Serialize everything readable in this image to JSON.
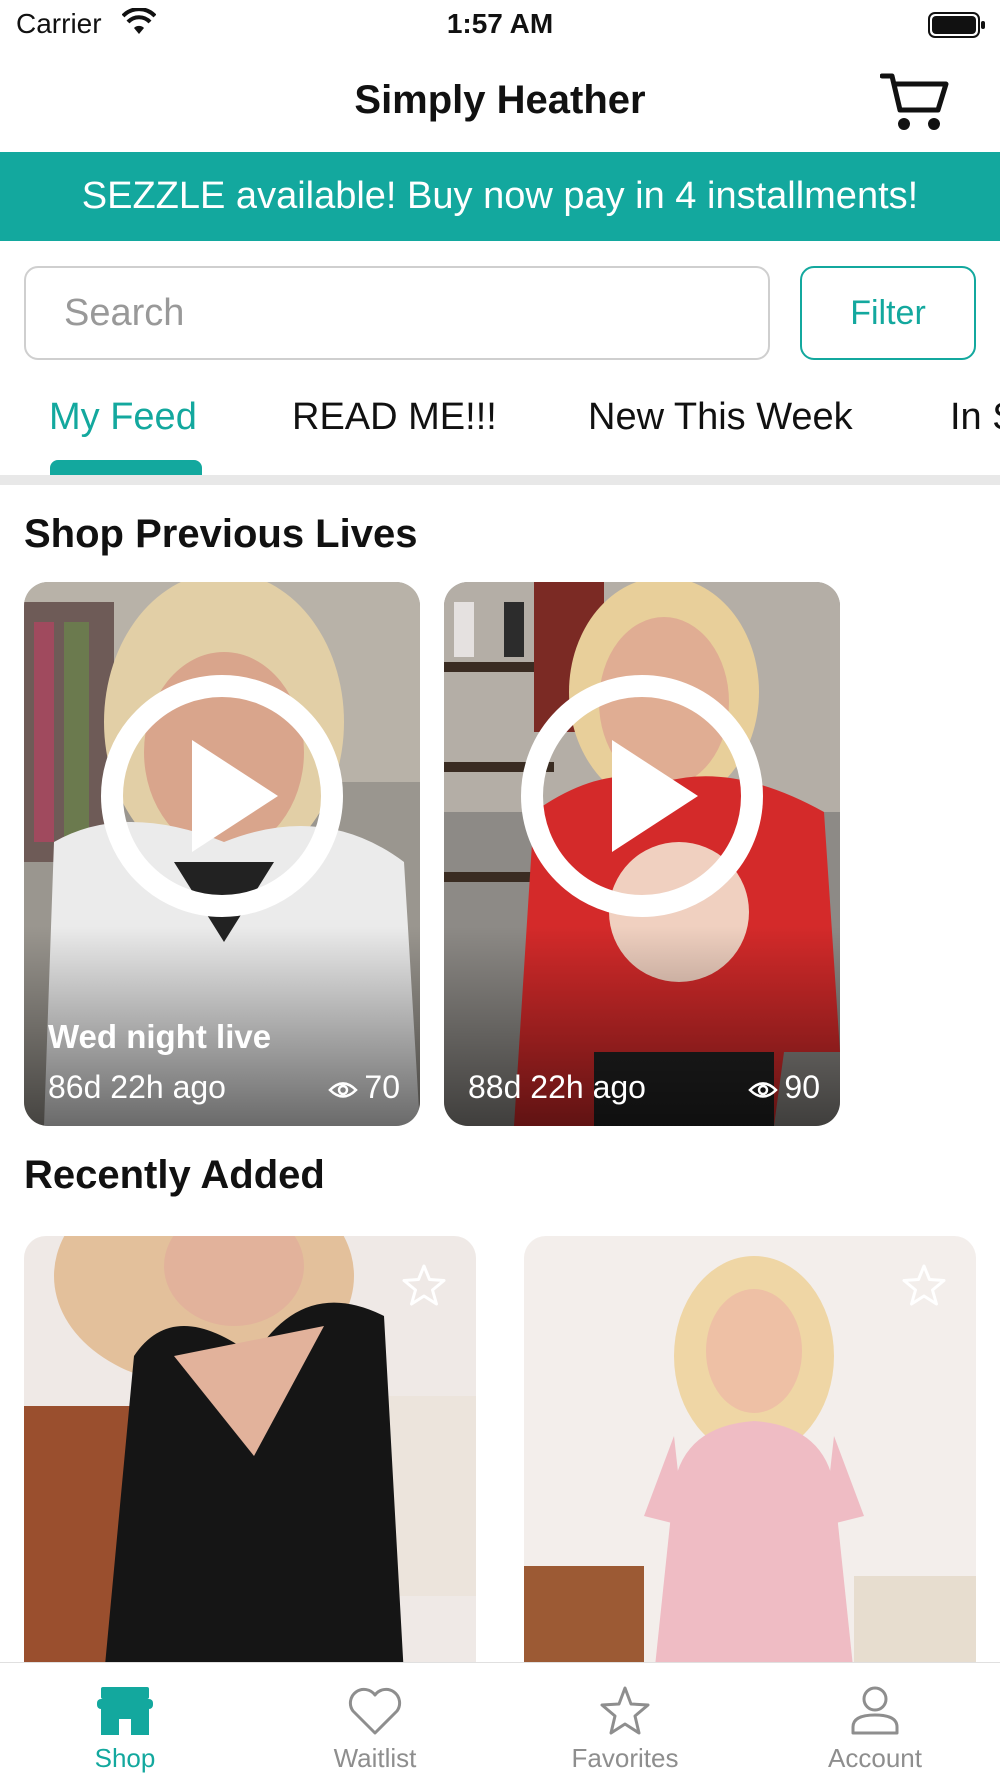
{
  "status_bar": {
    "carrier": "Carrier",
    "time": "1:57 AM"
  },
  "nav": {
    "title": "Simply Heather"
  },
  "banner": {
    "text": "SEZZLE available!  Buy now pay in 4 installments!"
  },
  "search": {
    "placeholder": "Search",
    "filter_label": "Filter"
  },
  "tabs": [
    {
      "label": "My Feed",
      "active": true
    },
    {
      "label": "READ ME!!!"
    },
    {
      "label": "New This Week"
    },
    {
      "label": "In S"
    }
  ],
  "previous_lives": {
    "title": "Shop Previous Lives",
    "items": [
      {
        "title": "Wed night live",
        "ago": "86d 22h ago",
        "views": "70"
      },
      {
        "title": "",
        "ago": "88d 22h ago",
        "views": "90"
      }
    ]
  },
  "recently_added": {
    "title": "Recently Added"
  },
  "tabbar": {
    "items": [
      {
        "label": "Shop",
        "icon": "store-icon",
        "active": true
      },
      {
        "label": "Waitlist",
        "icon": "heart-icon"
      },
      {
        "label": "Favorites",
        "icon": "star-icon"
      },
      {
        "label": "Account",
        "icon": "person-icon"
      }
    ]
  },
  "colors": {
    "accent": "#13a89e"
  }
}
